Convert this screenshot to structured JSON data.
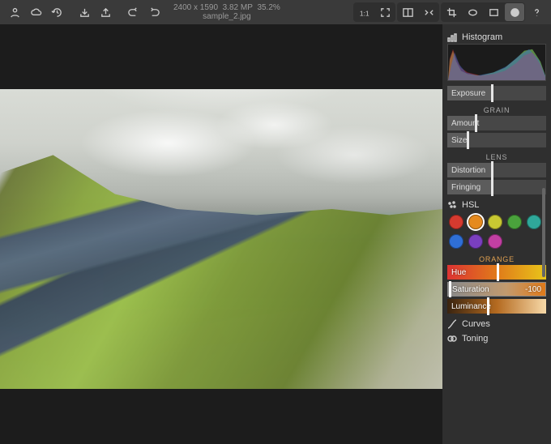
{
  "toolbar": {
    "info_dims": "2400 x 1590",
    "info_mp": "3.82 MP",
    "info_zoom": "35.2%",
    "filename": "sample_2.jpg"
  },
  "panel": {
    "histogram_label": "Histogram",
    "exposure_label": "Exposure",
    "grain": {
      "title": "GRAIN",
      "amount": "Amount",
      "size": "Size"
    },
    "lens": {
      "title": "LENS",
      "distortion": "Distortion",
      "fringing": "Fringing"
    },
    "hsl": {
      "title": "HSL",
      "selected_label": "ORANGE",
      "hue": "Hue",
      "saturation": "Saturation",
      "saturation_val": "-100",
      "luminance": "Luminance",
      "colors": [
        {
          "name": "red",
          "hex": "#d63a2f"
        },
        {
          "name": "orange",
          "hex": "#e58a1e"
        },
        {
          "name": "yellow",
          "hex": "#c8c832"
        },
        {
          "name": "green",
          "hex": "#4aa23c"
        },
        {
          "name": "aqua",
          "hex": "#2fa89a"
        },
        {
          "name": "blue",
          "hex": "#2f6fd6"
        },
        {
          "name": "purple",
          "hex": "#7a3fbf"
        },
        {
          "name": "magenta",
          "hex": "#c23fa3"
        }
      ],
      "selected_index": 1
    },
    "curves_label": "Curves",
    "toning_label": "Toning"
  }
}
